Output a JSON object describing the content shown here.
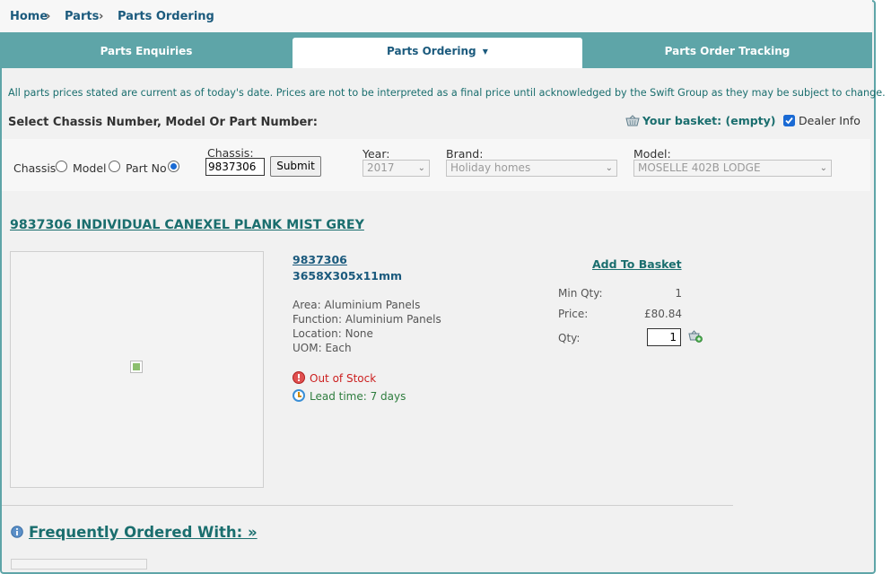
{
  "breadcrumb": {
    "items": [
      "Home",
      "Parts",
      "Parts Ordering"
    ],
    "separator_icon": "chevron-right-icon"
  },
  "tabs": [
    {
      "label": "Parts Enquiries",
      "active": false
    },
    {
      "label": "Parts Ordering",
      "active": true,
      "dropdown": true
    },
    {
      "label": "Parts Order Tracking",
      "active": false
    }
  ],
  "notice": "All parts prices stated are current as of today's date. Prices are not to be interpreted as a final price until acknowledged by the Swift Group as they may be subject to change.",
  "selector": {
    "title": "Select Chassis Number, Model Or Part Number:",
    "basket_label": "Your basket: (empty)",
    "dealer_info_label": "Dealer Info",
    "dealer_info_checked": true,
    "search_by": [
      {
        "label": "Chassis",
        "checked": false
      },
      {
        "label": "Model",
        "checked": false
      },
      {
        "label": "Part No",
        "checked": true
      }
    ],
    "chassis_label": "Chassis:",
    "chassis_value": "9837306",
    "submit_label": "Submit",
    "year_label": "Year:",
    "year_value": "2017",
    "brand_label": "Brand:",
    "brand_value": "Holiday homes",
    "model_label": "Model:",
    "model_value": "MOSELLE 402B LODGE"
  },
  "part": {
    "heading": "9837306 INDIVIDUAL CANEXEL PLANK MIST GREY",
    "number": "9837306",
    "size": "3658X305x11mm",
    "area": "Area: Aluminium Panels",
    "function": "Function: Aluminium Panels",
    "location": "Location: None",
    "uom": "UOM: Each",
    "stock_status": "Out of Stock",
    "lead_time": "Lead time: 7 days",
    "add_to_basket": "Add To Basket",
    "min_qty_label": "Min Qty:",
    "min_qty_value": "1",
    "price_label": "Price:",
    "price_value": "£80.84",
    "qty_label": "Qty:",
    "qty_value": "1"
  },
  "frequently_ordered": "Frequently Ordered With: »",
  "colors": {
    "teal": "#5ea5a8",
    "link_teal": "#1a6e6e",
    "navy": "#1b5a7d",
    "error_red": "#cc2020",
    "success_green": "#2e7d3e"
  }
}
